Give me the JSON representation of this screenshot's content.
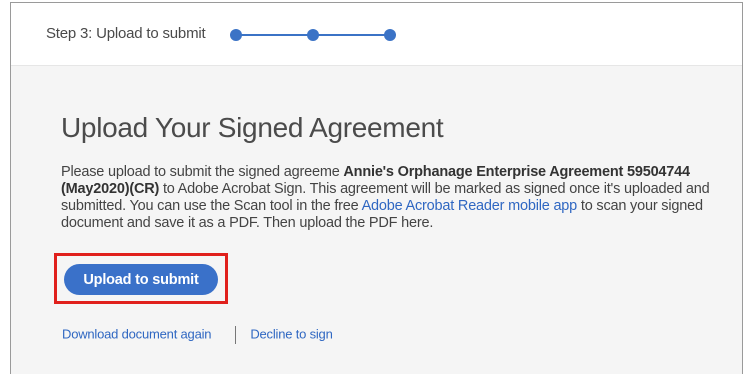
{
  "step": {
    "label": "Step 3: Upload to submit",
    "total_steps": 3,
    "current_step": 3,
    "accent_color": "#3b73c6"
  },
  "main": {
    "title": "Upload Your Signed Agreement",
    "desc_part1": "Please upload to submit the signed agreeme ",
    "agreement_name": "Annie's Orphanage Enterprise Agreement 59504744",
    "agreement_suffix": "(May2020)(CR)",
    "desc_part2": " to Adobe Acrobat Sign. This agreement will be marked as signed once it's uploaded and submitted. You can use the Scan tool in the free ",
    "app_link": "Adobe Acrobat Reader mobile app",
    "desc_part3": " to scan your signed document and save it as a PDF. Then upload the PDF here.",
    "upload_button": "Upload to submit"
  },
  "footer_links": {
    "download": "Download document again",
    "decline": "Decline to sign"
  },
  "colors": {
    "button": "#3a71c9",
    "link": "#2f67c2",
    "highlight": "#e0201c"
  }
}
